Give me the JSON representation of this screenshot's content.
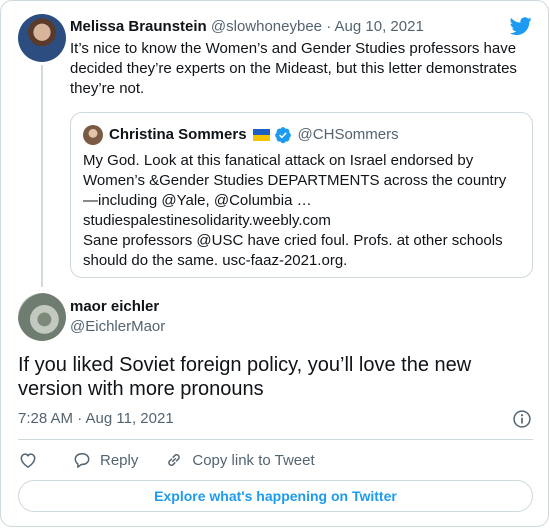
{
  "parent_tweet": {
    "name": "Melissa Braunstein",
    "handle": "@slowhoneybee",
    "separator": "·",
    "date": "Aug 10, 2021",
    "text": "It’s nice to know the Women’s and Gender Studies professors have decided they’re experts on the Mideast, but this letter demonstrates they’re not."
  },
  "quoted_tweet": {
    "name": "Christina Sommers",
    "handle": "@CHSommers",
    "lines": [
      "My God. Look at this fanatical attack on Israel endorsed by",
      "Women’s &Gender Studies DEPARTMENTS across the country",
      "—including @Yale, @Columbia  …",
      "studiespalestinesolidarity.weebly.com",
      "Sane professors @USC have cried foul.  Profs. at other schools",
      "should do the same.  usc-faaz-2021.org."
    ]
  },
  "reply_tweet": {
    "name": "maor eichler",
    "handle": "@EichlerMaor",
    "text": "If you liked Soviet foreign policy, you’ll love the new version with more pronouns",
    "timestamp": "7:28 AM · Aug 11, 2021"
  },
  "actions": {
    "reply_label": "Reply",
    "copy_label": "Copy link to Tweet"
  },
  "explore_label": "Explore what's happening on Twitter",
  "icons": {
    "brand": "twitter-bird-icon",
    "like": "heart-icon",
    "reply": "speech-bubble-icon",
    "copy": "link-icon",
    "info": "info-icon",
    "verified": "verified-badge-icon",
    "flag": "ukraine-flag-icon"
  },
  "colors": {
    "accent": "#1d9bf0",
    "text": "#0f1419",
    "muted": "#536471",
    "border": "#cfd9de"
  }
}
